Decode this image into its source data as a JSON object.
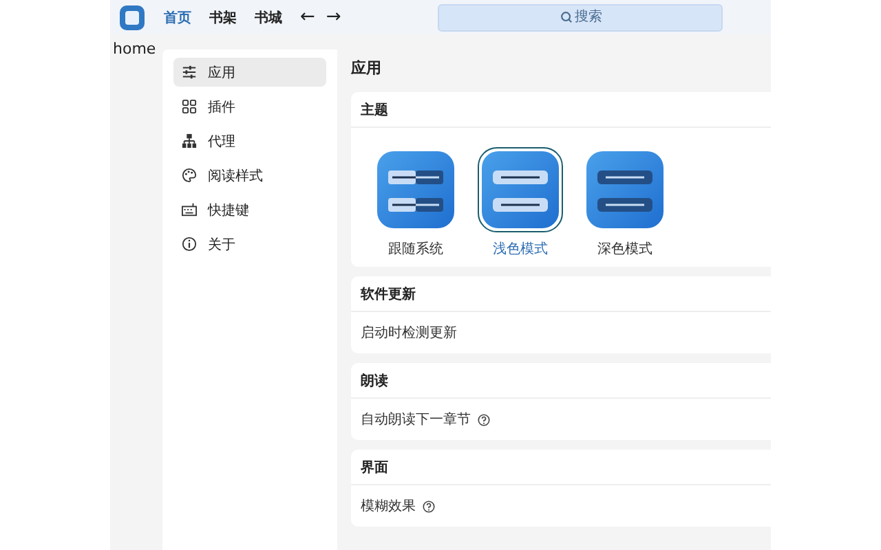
{
  "nav": {
    "tabs": [
      {
        "label": "首页",
        "selected": true
      },
      {
        "label": "书架",
        "selected": false
      },
      {
        "label": "书城",
        "selected": false
      }
    ],
    "back": "←",
    "forward": "→",
    "search": {
      "placeholder": "搜索"
    }
  },
  "breadcrumb": "home",
  "sidebar": {
    "items": [
      {
        "label": "应用",
        "kind": "sliders",
        "selected": true
      },
      {
        "label": "插件",
        "kind": "grid",
        "selected": false
      },
      {
        "label": "代理",
        "kind": "network",
        "selected": false
      },
      {
        "label": "阅读样式",
        "kind": "palette",
        "selected": false
      },
      {
        "label": "快捷键",
        "kind": "keyboard",
        "selected": false
      },
      {
        "label": "关于",
        "kind": "info",
        "selected": false
      }
    ]
  },
  "page_title": "应用",
  "theme": {
    "title": "主题",
    "options": [
      {
        "label": "跟随系统",
        "kind": "system",
        "selected": false
      },
      {
        "label": "浅色模式",
        "kind": "light",
        "selected": true
      },
      {
        "label": "深色模式",
        "kind": "dark",
        "selected": false
      }
    ]
  },
  "sections": [
    {
      "title": "软件更新",
      "rows": [
        {
          "label": "启动时检测更新",
          "help": false
        }
      ]
    },
    {
      "title": "朗读",
      "rows": [
        {
          "label": "自动朗读下一章节",
          "help": true
        }
      ]
    },
    {
      "title": "界面",
      "rows": [
        {
          "label": "模糊效果",
          "help": true
        }
      ]
    }
  ]
}
